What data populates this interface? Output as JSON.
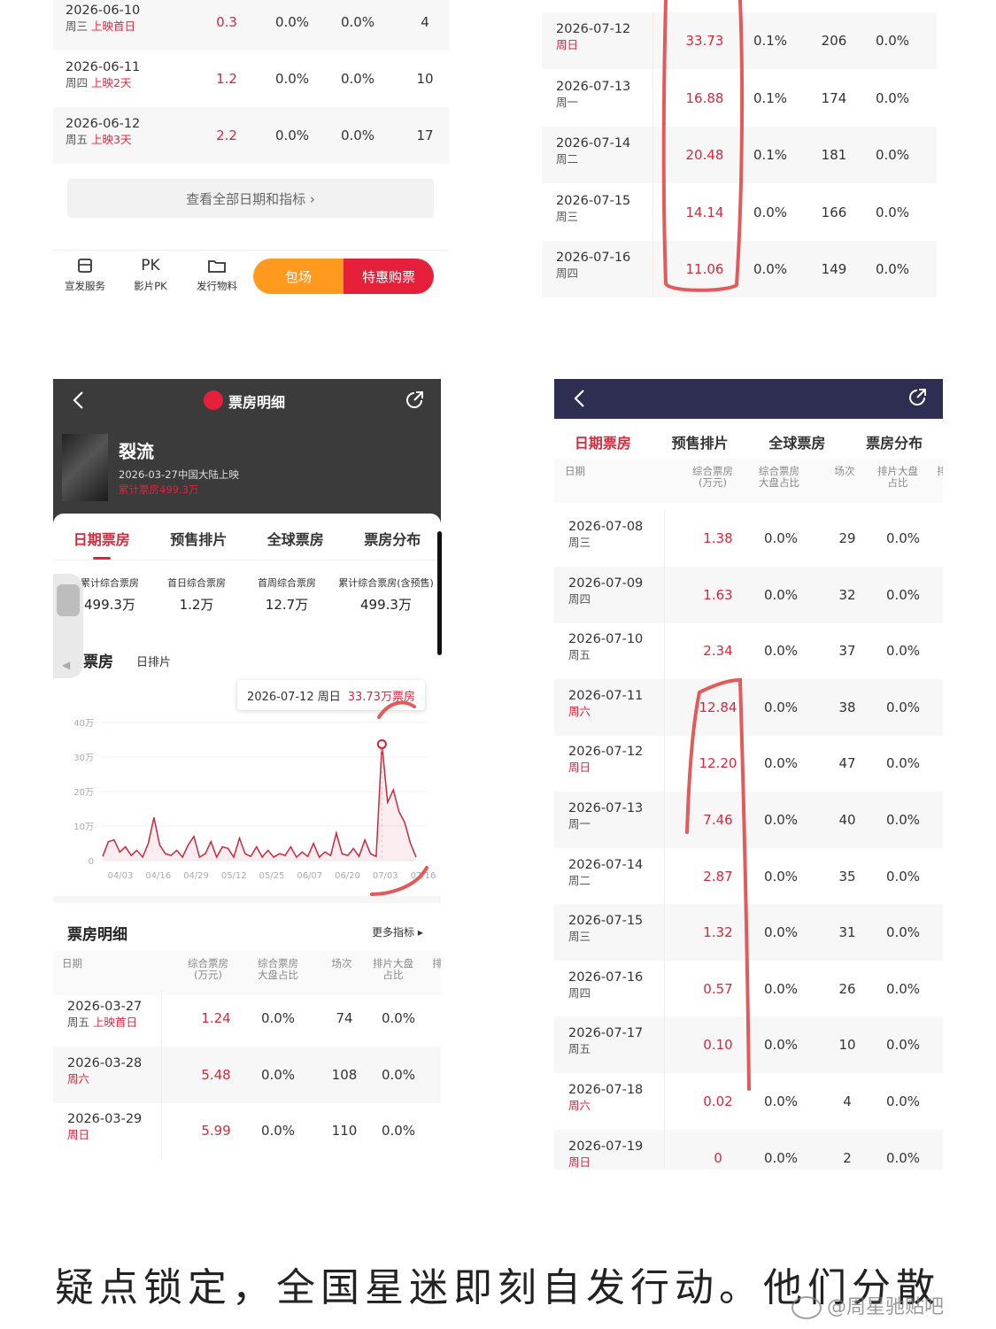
{
  "panel_tl": {
    "rows": [
      {
        "date": "2026-06-10",
        "week": "周三",
        "tag": "上映首日",
        "box": "0.3",
        "share": "0.0%",
        "seat": "0.0%",
        "shows": "4"
      },
      {
        "date": "2026-06-11",
        "week": "周四",
        "tag": "上映2天",
        "box": "1.2",
        "share": "0.0%",
        "seat": "0.0%",
        "shows": "10"
      },
      {
        "date": "2026-06-12",
        "week": "周五",
        "tag": "上映3天",
        "box": "2.2",
        "share": "0.0%",
        "seat": "0.0%",
        "shows": "17"
      }
    ],
    "view_all": "查看全部日期和指标 ›",
    "bottom": {
      "svc_label": "宣发服务",
      "pk_glyph": "PK",
      "pk_label": "影片PK",
      "material_label": "发行物料",
      "book_label": "包场",
      "buy_label": "特惠购票"
    }
  },
  "panel_tr": {
    "rows": [
      {
        "date": "2026-07-12",
        "week": "周日",
        "box": "33.73",
        "share": "0.1%",
        "shows": "206",
        "seat": "0.0%"
      },
      {
        "date": "2026-07-13",
        "week": "周一",
        "box": "16.88",
        "share": "0.1%",
        "shows": "174",
        "seat": "0.0%"
      },
      {
        "date": "2026-07-14",
        "week": "周二",
        "box": "20.48",
        "share": "0.1%",
        "shows": "181",
        "seat": "0.0%"
      },
      {
        "date": "2026-07-15",
        "week": "周三",
        "box": "14.14",
        "share": "0.0%",
        "shows": "166",
        "seat": "0.0%"
      },
      {
        "date": "2026-07-16",
        "week": "周四",
        "box": "11.06",
        "share": "0.0%",
        "shows": "149",
        "seat": "0.0%"
      }
    ]
  },
  "panel_bl": {
    "header_title": "票房明细",
    "movie": {
      "title": "裂流",
      "release": "2026-03-27中国大陆上映",
      "total": "累计票房499.3万"
    },
    "tabs": [
      "日期票房",
      "预售排片",
      "全球票房",
      "票房分布"
    ],
    "stats": [
      {
        "label": "累计综合票房",
        "value": "499.3万"
      },
      {
        "label": "首日综合票房",
        "value": "1.2万"
      },
      {
        "label": "首周综合票房",
        "value": "12.7万"
      },
      {
        "label": "累计综合票房(含预售)",
        "value": "499.3万"
      }
    ],
    "chart_tabs": {
      "active": "票房",
      "other": "日排片"
    },
    "tooltip": {
      "date": "2026-07-12 周日",
      "value": "33.73万票房"
    },
    "table_title": "票房明细",
    "more": "更多指标 ▸",
    "headers": [
      "日期",
      "综合票房\n(万元)",
      "综合票房\n大盘占比",
      "场次",
      "排片大盘\n占比",
      "排"
    ],
    "rows": [
      {
        "date": "2026-03-27",
        "week": "周五",
        "tag": "上映首日",
        "box": "1.24",
        "share": "0.0%",
        "shows": "74",
        "seat": "0.0%"
      },
      {
        "date": "2026-03-28",
        "week": "周六",
        "tag": "",
        "box": "5.48",
        "share": "0.0%",
        "shows": "108",
        "seat": "0.0%"
      },
      {
        "date": "2026-03-29",
        "week": "周日",
        "tag": "",
        "box": "5.99",
        "share": "0.0%",
        "shows": "110",
        "seat": "0.0%"
      }
    ]
  },
  "chart_data": {
    "type": "line",
    "title": "",
    "xlabel": "",
    "ylabel": "",
    "x_ticks": [
      "04/03",
      "04/16",
      "04/29",
      "05/12",
      "05/25",
      "06/07",
      "06/20",
      "07/03",
      "07/16"
    ],
    "y_ticks": [
      "0",
      "10万",
      "20万",
      "30万",
      "40万"
    ],
    "ylim": [
      0,
      40
    ],
    "series": [
      {
        "values": [
          1.2,
          5.5,
          6.0,
          2.5,
          4.0,
          1.5,
          3.0,
          1.0,
          5.0,
          12.5,
          4.5,
          2.0,
          1.5,
          3.0,
          1.0,
          4.5,
          7.0,
          1.0,
          2.0,
          5.5,
          1.0,
          4.0,
          3.5,
          1.0,
          6.5,
          2.0,
          1.2,
          4.0,
          1.0,
          3.0,
          1.0,
          2.0,
          1.5,
          4.0,
          1.0,
          2.5,
          1.2,
          5.0,
          1.0,
          2.5,
          1.5,
          8.0,
          2.0,
          1.5,
          3.5,
          1.2,
          6.0,
          2.0,
          1.2,
          33.73,
          16.88,
          20.48,
          14.14,
          11.06,
          5.0,
          1.0
        ]
      }
    ],
    "highlight": {
      "x": "2026-07-12",
      "value": 33.73
    }
  },
  "panel_br": {
    "tabs": [
      "日期票房",
      "预售排片",
      "全球票房",
      "票房分布"
    ],
    "headers": [
      "日期",
      "综合票房\n(万元)",
      "综合票房\n大盘占比",
      "场次",
      "排片大盘\n占比",
      "排"
    ],
    "rows": [
      {
        "date": "2026-07-08",
        "week": "周三",
        "box": "1.38",
        "share": "0.0%",
        "shows": "29",
        "seat": "0.0%",
        "weekend": false
      },
      {
        "date": "2026-07-09",
        "week": "周四",
        "box": "1.63",
        "share": "0.0%",
        "shows": "32",
        "seat": "0.0%",
        "weekend": false
      },
      {
        "date": "2026-07-10",
        "week": "周五",
        "box": "2.34",
        "share": "0.0%",
        "shows": "37",
        "seat": "0.0%",
        "weekend": false
      },
      {
        "date": "2026-07-11",
        "week": "周六",
        "box": "12.84",
        "share": "0.0%",
        "shows": "38",
        "seat": "0.0%",
        "weekend": true
      },
      {
        "date": "2026-07-12",
        "week": "周日",
        "box": "12.20",
        "share": "0.0%",
        "shows": "47",
        "seat": "0.0%",
        "weekend": true
      },
      {
        "date": "2026-07-13",
        "week": "周一",
        "box": "7.46",
        "share": "0.0%",
        "shows": "40",
        "seat": "0.0%",
        "weekend": false
      },
      {
        "date": "2026-07-14",
        "week": "周二",
        "box": "2.87",
        "share": "0.0%",
        "shows": "35",
        "seat": "0.0%",
        "weekend": false
      },
      {
        "date": "2026-07-15",
        "week": "周三",
        "box": "1.32",
        "share": "0.0%",
        "shows": "31",
        "seat": "0.0%",
        "weekend": false
      },
      {
        "date": "2026-07-16",
        "week": "周四",
        "box": "0.57",
        "share": "0.0%",
        "shows": "26",
        "seat": "0.0%",
        "weekend": false
      },
      {
        "date": "2026-07-17",
        "week": "周五",
        "box": "0.10",
        "share": "0.0%",
        "shows": "10",
        "seat": "0.0%",
        "weekend": false
      },
      {
        "date": "2026-07-18",
        "week": "周六",
        "box": "0.02",
        "share": "0.0%",
        "shows": "4",
        "seat": "0.0%",
        "weekend": true
      },
      {
        "date": "2026-07-19",
        "week": "周日",
        "box": "0",
        "share": "0.0%",
        "shows": "2",
        "seat": "0.0%",
        "weekend": true
      }
    ]
  },
  "caption": "疑点锁定，全国星迷即刻自发行动。他们分散",
  "watermark": "@周星驰贴吧",
  "colors": {
    "accent": "#d6283b",
    "orange": "#ff9a1f",
    "annotation": "#e35a5a",
    "dark_header": "#3b3b3b",
    "navy_header": "#2e2d52"
  }
}
